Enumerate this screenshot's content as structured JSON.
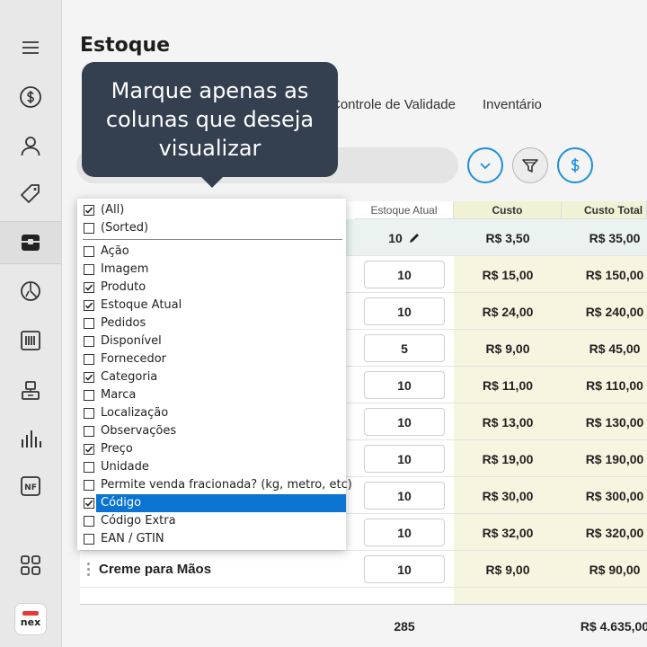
{
  "page": {
    "title": "Estoque"
  },
  "sidebar": {
    "items": [
      {
        "icon": "menu-icon"
      },
      {
        "icon": "dollar-icon"
      },
      {
        "icon": "user-icon"
      },
      {
        "icon": "tag-icon"
      },
      {
        "icon": "box-icon",
        "active": true
      },
      {
        "icon": "pie-icon"
      },
      {
        "icon": "barcode-icon"
      },
      {
        "icon": "scale-icon"
      },
      {
        "icon": "chart-icon"
      },
      {
        "icon": "nf-icon",
        "label": "NF"
      },
      {
        "icon": "grid-icon"
      }
    ],
    "logo": "nex"
  },
  "tabs": [
    "Controle de Validade",
    "Inventário"
  ],
  "colors": {
    "accent": "#1f8fdb",
    "selection": "#0a74d0",
    "tooltip_bg": "#344050"
  },
  "table": {
    "headers": {
      "stock": "Estoque Atual",
      "cost": "Custo",
      "total_cost": "Custo Total"
    },
    "rows": [
      {
        "qty": "10",
        "cost": "R$ 3,50",
        "total": "R$ 35,00",
        "editing": true
      },
      {
        "qty": "10",
        "cost": "R$ 15,00",
        "total": "R$ 150,00"
      },
      {
        "qty": "10",
        "cost": "R$ 24,00",
        "total": "R$ 240,00"
      },
      {
        "qty": "5",
        "cost": "R$ 9,00",
        "total": "R$ 45,00"
      },
      {
        "qty": "10",
        "cost": "R$ 11,00",
        "total": "R$ 110,00"
      },
      {
        "qty": "10",
        "cost": "R$ 13,00",
        "total": "R$ 130,00"
      },
      {
        "qty": "10",
        "cost": "R$ 19,00",
        "total": "R$ 190,00"
      },
      {
        "qty": "10",
        "cost": "R$ 30,00",
        "total": "R$ 300,00"
      },
      {
        "qty": "10",
        "cost": "R$ 32,00",
        "total": "R$ 320,00"
      },
      {
        "name": "Creme para Mãos",
        "qty": "10",
        "cost": "R$ 9,00",
        "total": "R$ 90,00"
      }
    ],
    "footer": {
      "qty": "285",
      "total": "R$ 4.635,00"
    }
  },
  "column_chooser": {
    "options": [
      {
        "label": "(All)",
        "checked": true
      },
      {
        "label": "(Sorted)",
        "checked": false
      },
      {
        "label": "Ação",
        "checked": false
      },
      {
        "label": "Imagem",
        "checked": false
      },
      {
        "label": "Produto",
        "checked": true
      },
      {
        "label": "Estoque Atual",
        "checked": true
      },
      {
        "label": "Pedidos",
        "checked": false
      },
      {
        "label": "Disponível",
        "checked": false
      },
      {
        "label": "Fornecedor",
        "checked": false
      },
      {
        "label": "Categoria",
        "checked": true
      },
      {
        "label": "Marca",
        "checked": false
      },
      {
        "label": "Localização",
        "checked": false
      },
      {
        "label": "Observações",
        "checked": false
      },
      {
        "label": "Preço",
        "checked": true
      },
      {
        "label": "Unidade",
        "checked": false
      },
      {
        "label": "Permite venda fracionada? (kg, metro, etc)",
        "checked": false
      },
      {
        "label": "Código",
        "checked": true,
        "selected": true
      },
      {
        "label": "Código Extra",
        "checked": false
      },
      {
        "label": "EAN / GTIN",
        "checked": false
      }
    ]
  },
  "tooltip": {
    "text": "Marque apenas as colunas que deseja visualizar"
  }
}
